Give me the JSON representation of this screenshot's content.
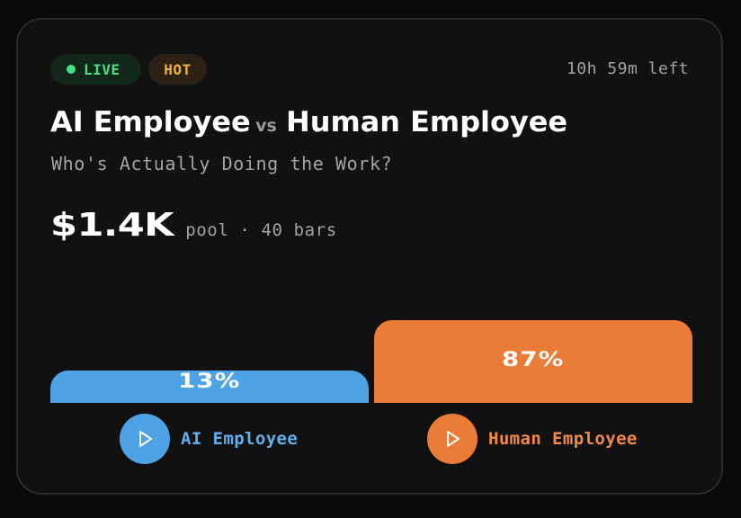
{
  "badges": {
    "live": "LIVE",
    "hot": "HOT"
  },
  "time_left": "10h 59m left",
  "title": {
    "left": "AI Employee",
    "vs": "vs",
    "right": "Human Employee"
  },
  "subtitle": "Who's Actually Doing the Work?",
  "pool": {
    "amount": "$1.4K",
    "label": "pool · 40 bars"
  },
  "split": {
    "ai": {
      "percent": 13,
      "label": "13%"
    },
    "human": {
      "percent": 87,
      "label": "87%"
    }
  },
  "options": {
    "ai": {
      "label": "AI Employee",
      "icon": "play-icon"
    },
    "human": {
      "label": "Human Employee",
      "icon": "play-icon"
    }
  },
  "colors": {
    "ai": "#4da3e6",
    "human": "#ea7c37",
    "live": "#4ade80",
    "hot": "#f2b23a"
  }
}
